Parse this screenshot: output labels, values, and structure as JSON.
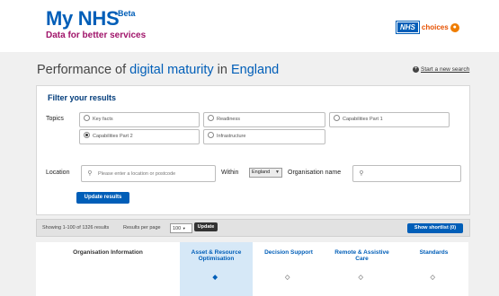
{
  "header": {
    "brand": "My NHS",
    "beta": "Beta",
    "tagline": "Data for better services",
    "logo_nhs": "NHS",
    "logo_choices": "choices",
    "brand_color": "#005eb8",
    "tagline_color": "#a0146a"
  },
  "title": {
    "part1": "Performance of ",
    "part2": "digital maturity",
    "part3": " in ",
    "part4": "England"
  },
  "start_new_search": "Start a new search",
  "filter": {
    "title": "Filter your results",
    "topics_label": "Topics",
    "topics": [
      {
        "label": "Key facts",
        "selected": false
      },
      {
        "label": "Readiness",
        "selected": false
      },
      {
        "label": "Capabilities Part 1",
        "selected": false
      },
      {
        "label": "Capabilities Part 2",
        "selected": true
      },
      {
        "label": "Infrastructure",
        "selected": false
      }
    ],
    "location_label": "Location",
    "location_placeholder": "Please enter a location or postcode",
    "within_label": "Within",
    "within_value": "England",
    "org_name_label": "Organisation name",
    "org_name_placeholder": "",
    "update_results": "Update results"
  },
  "results": {
    "showing": "Showing 1-100 of 1326 results",
    "per_page_label": "Results per page",
    "per_page_value": "100",
    "update": "Update",
    "shortlist": "Show shortlist (0)"
  },
  "columns": [
    "Organisation Information",
    "Asset & Resource Optimisation",
    "Decision Support",
    "Remote & Assistive Care",
    "Standards"
  ]
}
